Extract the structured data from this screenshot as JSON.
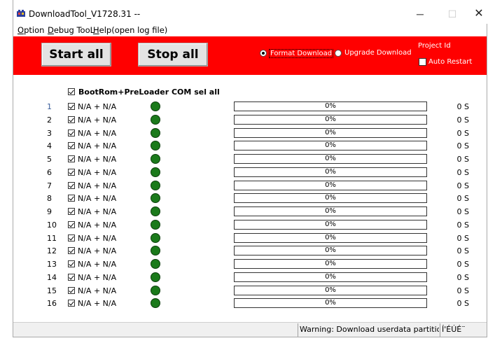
{
  "window": {
    "title": "DownloadTool_V1728.31 --",
    "minimize_glyph": "─",
    "maximize_glyph": "☐",
    "close_glyph": "✕"
  },
  "menu": [
    {
      "accel": "O",
      "rest": "ption"
    },
    {
      "accel": "D",
      "rest": "ebug TooL"
    },
    {
      "accel": "H",
      "rest": "elp(open log file)"
    }
  ],
  "toolbar": {
    "start_label": "Start all",
    "stop_label": "Stop all",
    "format_label": "Format Download",
    "format_selected": true,
    "upgrade_label": "Upgrade Download",
    "project_id_label": "Project Id",
    "auto_restart_label": "Auto Restart",
    "auto_restart_checked": false,
    "bg_color": "#ff0000"
  },
  "select_all": {
    "label": "BootRom+PreLoader COM sel all",
    "checked": true
  },
  "ports": [
    {
      "num": "1",
      "port": "N/A + N/A",
      "checked": true,
      "progress": 0,
      "pct": "0%",
      "time": "0 S"
    },
    {
      "num": "2",
      "port": "N/A + N/A",
      "checked": true,
      "progress": 0,
      "pct": "0%",
      "time": "0 S"
    },
    {
      "num": "3",
      "port": "N/A + N/A",
      "checked": true,
      "progress": 0,
      "pct": "0%",
      "time": "0 S"
    },
    {
      "num": "4",
      "port": "N/A + N/A",
      "checked": true,
      "progress": 0,
      "pct": "0%",
      "time": "0 S"
    },
    {
      "num": "5",
      "port": "N/A + N/A",
      "checked": true,
      "progress": 0,
      "pct": "0%",
      "time": "0 S"
    },
    {
      "num": "6",
      "port": "N/A + N/A",
      "checked": true,
      "progress": 0,
      "pct": "0%",
      "time": "0 S"
    },
    {
      "num": "7",
      "port": "N/A + N/A",
      "checked": true,
      "progress": 0,
      "pct": "0%",
      "time": "0 S"
    },
    {
      "num": "8",
      "port": "N/A + N/A",
      "checked": true,
      "progress": 0,
      "pct": "0%",
      "time": "0 S"
    },
    {
      "num": "9",
      "port": "N/A + N/A",
      "checked": true,
      "progress": 0,
      "pct": "0%",
      "time": "0 S"
    },
    {
      "num": "10",
      "port": "N/A + N/A",
      "checked": true,
      "progress": 0,
      "pct": "0%",
      "time": "0 S"
    },
    {
      "num": "11",
      "port": "N/A + N/A",
      "checked": true,
      "progress": 0,
      "pct": "0%",
      "time": "0 S"
    },
    {
      "num": "12",
      "port": "N/A + N/A",
      "checked": true,
      "progress": 0,
      "pct": "0%",
      "time": "0 S"
    },
    {
      "num": "13",
      "port": "N/A + N/A",
      "checked": true,
      "progress": 0,
      "pct": "0%",
      "time": "0 S"
    },
    {
      "num": "14",
      "port": "N/A + N/A",
      "checked": true,
      "progress": 0,
      "pct": "0%",
      "time": "0 S"
    },
    {
      "num": "15",
      "port": "N/A + N/A",
      "checked": true,
      "progress": 0,
      "pct": "0%",
      "time": "0 S"
    },
    {
      "num": "16",
      "port": "N/A + N/A",
      "checked": true,
      "progress": 0,
      "pct": "0%",
      "time": "0 S"
    }
  ],
  "status_led_color": "#1b7a1b",
  "statusbar": {
    "message": "Warning: Download userdata partition,will lo",
    "extra": "Í'ÉÚÉ¨"
  }
}
